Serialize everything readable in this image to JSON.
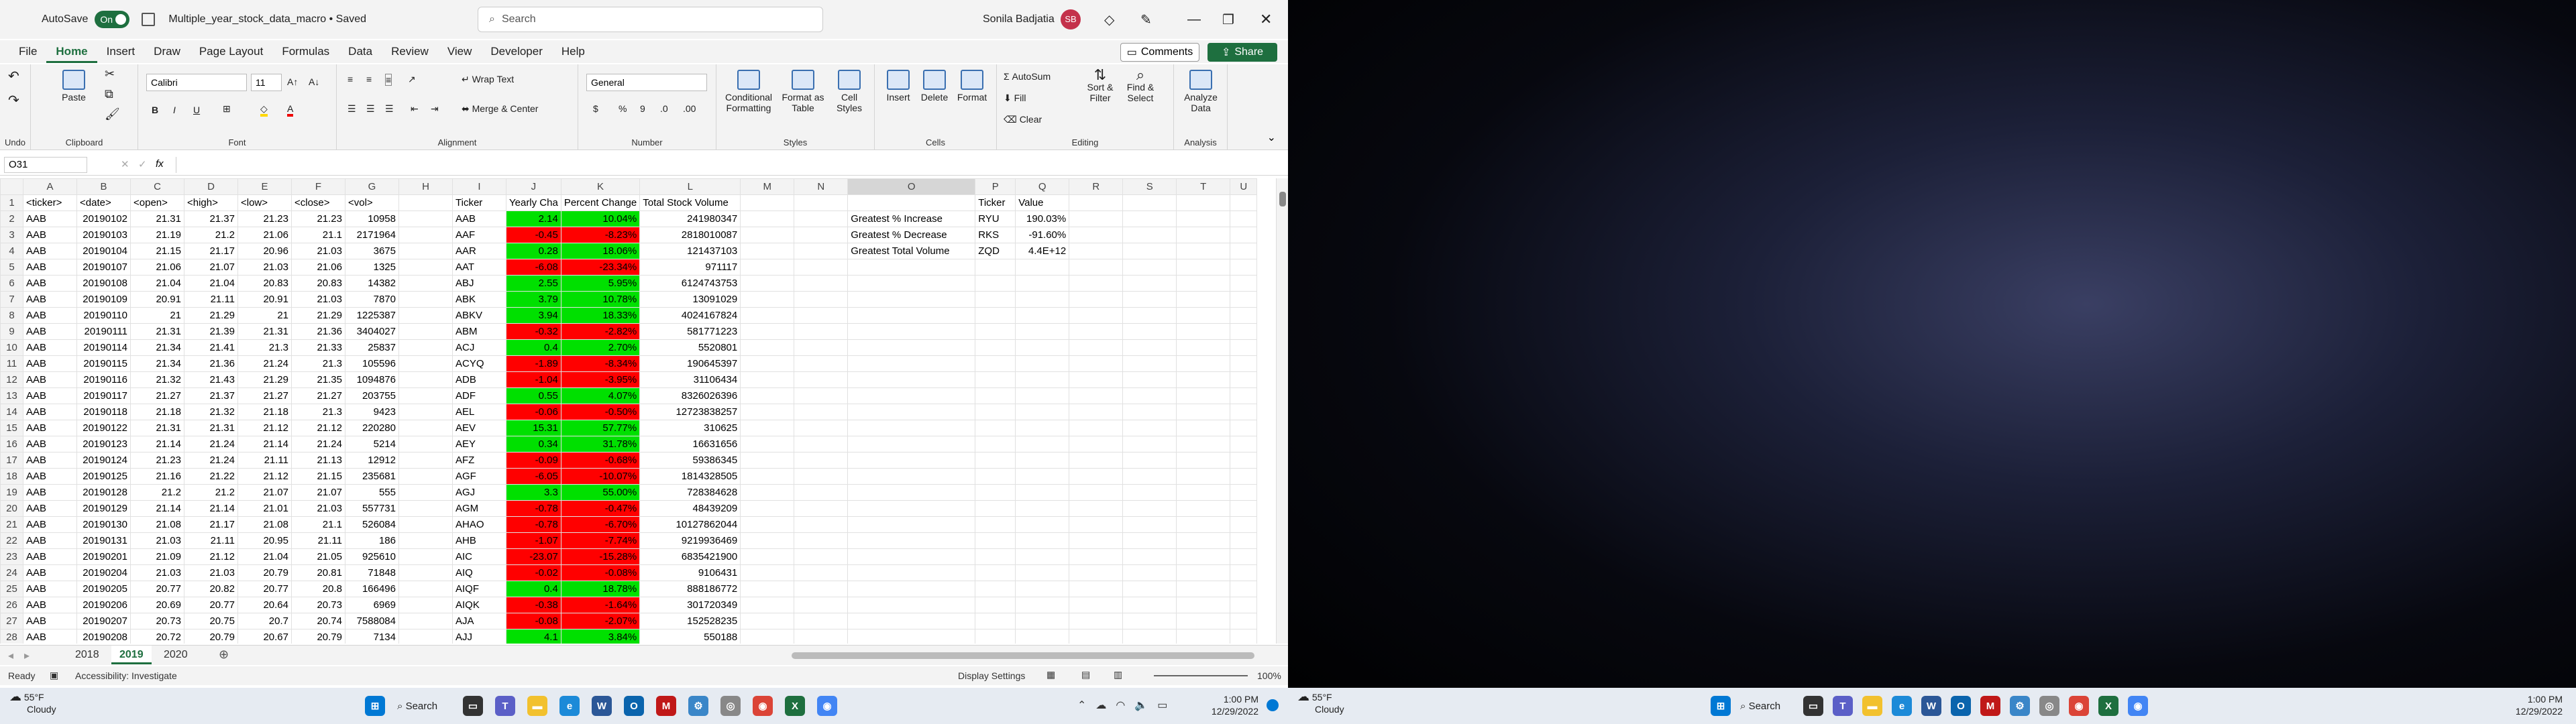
{
  "titlebar": {
    "autosave": "AutoSave",
    "toggle": "On",
    "filename": "Multiple_year_stock_data_macro • Saved",
    "search_placeholder": "Search",
    "user": "Sonila Badjatia",
    "initials": "SB"
  },
  "menu": [
    "File",
    "Home",
    "Insert",
    "Draw",
    "Page Layout",
    "Formulas",
    "Data",
    "Review",
    "View",
    "Developer",
    "Help"
  ],
  "buttons": {
    "comments": "Comments",
    "share": "Share"
  },
  "ribbon": {
    "undo": "Undo",
    "paste": "Paste",
    "clipboard": "Clipboard",
    "font_name": "Calibri",
    "font_size": "11",
    "font": "Font",
    "wrap": "Wrap Text",
    "merge": "Merge & Center",
    "alignment": "Alignment",
    "number_format": "General",
    "number": "Number",
    "conditional": "Conditional Formatting",
    "format_table": "Format as Table",
    "cell_styles": "Cell Styles",
    "styles": "Styles",
    "insert": "Insert",
    "delete": "Delete",
    "format": "Format",
    "cells": "Cells",
    "autosum": "AutoSum",
    "fill": "Fill",
    "clear": "Clear",
    "sort": "Sort & Filter",
    "find": "Find & Select",
    "editing": "Editing",
    "analyze": "Analyze Data",
    "analysis": "Analysis"
  },
  "formula_bar": {
    "name_box": "O31",
    "fx": "fx",
    "value": ""
  },
  "columns": [
    "A",
    "B",
    "C",
    "D",
    "E",
    "F",
    "G",
    "H",
    "I",
    "J",
    "K",
    "L",
    "M",
    "N",
    "O",
    "P",
    "Q",
    "R",
    "S",
    "T",
    "U"
  ],
  "rows": [
    [
      "<ticker>",
      "<date>",
      "<open>",
      "<high>",
      "<low>",
      "<close>",
      "<vol>",
      "",
      "Ticker",
      "Yearly Cha",
      "Percent Change",
      "Total Stock Volume",
      "",
      "",
      "",
      "Ticker",
      "Value",
      "",
      "",
      "",
      ""
    ],
    [
      "AAB",
      "20190102",
      "21.31",
      "21.37",
      "21.23",
      "21.23",
      "10958",
      "",
      "AAB",
      "2.14",
      "10.04%",
      "241980347",
      "",
      "",
      "Greatest % Increase",
      "RYU",
      "190.03%",
      "",
      "",
      "",
      ""
    ],
    [
      "AAB",
      "20190103",
      "21.19",
      "21.2",
      "21.06",
      "21.1",
      "2171964",
      "",
      "AAF",
      "-0.45",
      "-8.23%",
      "2818010087",
      "",
      "",
      "Greatest % Decrease",
      "RKS",
      "-91.60%",
      "",
      "",
      "",
      ""
    ],
    [
      "AAB",
      "20190104",
      "21.15",
      "21.17",
      "20.96",
      "21.03",
      "3675",
      "",
      "AAR",
      "0.28",
      "18.06%",
      "121437103",
      "",
      "",
      "Greatest Total Volume",
      "ZQD",
      "4.4E+12",
      "",
      "",
      "",
      ""
    ],
    [
      "AAB",
      "20190107",
      "21.06",
      "21.07",
      "21.03",
      "21.06",
      "1325",
      "",
      "AAT",
      "-6.08",
      "-23.34%",
      "971117",
      "",
      "",
      "",
      "",
      "",
      "",
      "",
      "",
      ""
    ],
    [
      "AAB",
      "20190108",
      "21.04",
      "21.04",
      "20.83",
      "20.83",
      "14382",
      "",
      "ABJ",
      "2.55",
      "5.95%",
      "6124743753",
      "",
      "",
      "",
      "",
      "",
      "",
      "",
      "",
      ""
    ],
    [
      "AAB",
      "20190109",
      "20.91",
      "21.11",
      "20.91",
      "21.03",
      "7870",
      "",
      "ABK",
      "3.79",
      "10.78%",
      "13091029",
      "",
      "",
      "",
      "",
      "",
      "",
      "",
      "",
      ""
    ],
    [
      "AAB",
      "20190110",
      "21",
      "21.29",
      "21",
      "21.29",
      "1225387",
      "",
      "ABKV",
      "3.94",
      "18.33%",
      "4024167824",
      "",
      "",
      "",
      "",
      "",
      "",
      "",
      "",
      ""
    ],
    [
      "AAB",
      "20190111",
      "21.31",
      "21.39",
      "21.31",
      "21.36",
      "3404027",
      "",
      "ABM",
      "-0.32",
      "-2.82%",
      "581771223",
      "",
      "",
      "",
      "",
      "",
      "",
      "",
      "",
      ""
    ],
    [
      "AAB",
      "20190114",
      "21.34",
      "21.41",
      "21.3",
      "21.33",
      "25837",
      "",
      "ACJ",
      "0.4",
      "2.70%",
      "5520801",
      "",
      "",
      "",
      "",
      "",
      "",
      "",
      "",
      ""
    ],
    [
      "AAB",
      "20190115",
      "21.34",
      "21.36",
      "21.24",
      "21.3",
      "105596",
      "",
      "ACYQ",
      "-1.89",
      "-8.34%",
      "190645397",
      "",
      "",
      "",
      "",
      "",
      "",
      "",
      "",
      ""
    ],
    [
      "AAB",
      "20190116",
      "21.32",
      "21.43",
      "21.29",
      "21.35",
      "1094876",
      "",
      "ADB",
      "-1.04",
      "-3.95%",
      "31106434",
      "",
      "",
      "",
      "",
      "",
      "",
      "",
      "",
      ""
    ],
    [
      "AAB",
      "20190117",
      "21.27",
      "21.37",
      "21.27",
      "21.27",
      "203755",
      "",
      "ADF",
      "0.55",
      "4.07%",
      "8326026396",
      "",
      "",
      "",
      "",
      "",
      "",
      "",
      "",
      ""
    ],
    [
      "AAB",
      "20190118",
      "21.18",
      "21.32",
      "21.18",
      "21.3",
      "9423",
      "",
      "AEL",
      "-0.06",
      "-0.50%",
      "12723838257",
      "",
      "",
      "",
      "",
      "",
      "",
      "",
      "",
      ""
    ],
    [
      "AAB",
      "20190122",
      "21.31",
      "21.31",
      "21.12",
      "21.12",
      "220280",
      "",
      "AEV",
      "15.31",
      "57.77%",
      "310625",
      "",
      "",
      "",
      "",
      "",
      "",
      "",
      "",
      ""
    ],
    [
      "AAB",
      "20190123",
      "21.14",
      "21.24",
      "21.14",
      "21.24",
      "5214",
      "",
      "AEY",
      "0.34",
      "31.78%",
      "16631656",
      "",
      "",
      "",
      "",
      "",
      "",
      "",
      "",
      ""
    ],
    [
      "AAB",
      "20190124",
      "21.23",
      "21.24",
      "21.11",
      "21.13",
      "12912",
      "",
      "AFZ",
      "-0.09",
      "-0.68%",
      "59386345",
      "",
      "",
      "",
      "",
      "",
      "",
      "",
      "",
      ""
    ],
    [
      "AAB",
      "20190125",
      "21.16",
      "21.22",
      "21.12",
      "21.15",
      "235681",
      "",
      "AGF",
      "-6.05",
      "-10.07%",
      "1814328505",
      "",
      "",
      "",
      "",
      "",
      "",
      "",
      "",
      ""
    ],
    [
      "AAB",
      "20190128",
      "21.2",
      "21.2",
      "21.07",
      "21.07",
      "555",
      "",
      "AGJ",
      "3.3",
      "55.00%",
      "728384628",
      "",
      "",
      "",
      "",
      "",
      "",
      "",
      "",
      ""
    ],
    [
      "AAB",
      "20190129",
      "21.14",
      "21.14",
      "21.01",
      "21.03",
      "557731",
      "",
      "AGM",
      "-0.78",
      "-0.47%",
      "48439209",
      "",
      "",
      "",
      "",
      "",
      "",
      "",
      "",
      ""
    ],
    [
      "AAB",
      "20190130",
      "21.08",
      "21.17",
      "21.08",
      "21.1",
      "526084",
      "",
      "AHAO",
      "-0.78",
      "-6.70%",
      "10127862044",
      "",
      "",
      "",
      "",
      "",
      "",
      "",
      "",
      ""
    ],
    [
      "AAB",
      "20190131",
      "21.03",
      "21.11",
      "20.95",
      "21.11",
      "186",
      "",
      "AHB",
      "-1.07",
      "-7.74%",
      "9219936469",
      "",
      "",
      "",
      "",
      "",
      "",
      "",
      "",
      ""
    ],
    [
      "AAB",
      "20190201",
      "21.09",
      "21.12",
      "21.04",
      "21.05",
      "925610",
      "",
      "AIC",
      "-23.07",
      "-15.28%",
      "6835421900",
      "",
      "",
      "",
      "",
      "",
      "",
      "",
      "",
      ""
    ],
    [
      "AAB",
      "20190204",
      "21.03",
      "21.03",
      "20.79",
      "20.81",
      "71848",
      "",
      "AIQ",
      "-0.02",
      "-0.08%",
      "9106431",
      "",
      "",
      "",
      "",
      "",
      "",
      "",
      "",
      ""
    ],
    [
      "AAB",
      "20190205",
      "20.77",
      "20.82",
      "20.77",
      "20.8",
      "166496",
      "",
      "AIQF",
      "0.4",
      "18.78%",
      "888186772",
      "",
      "",
      "",
      "",
      "",
      "",
      "",
      "",
      ""
    ],
    [
      "AAB",
      "20190206",
      "20.69",
      "20.77",
      "20.64",
      "20.73",
      "6969",
      "",
      "AIQK",
      "-0.38",
      "-1.64%",
      "301720349",
      "",
      "",
      "",
      "",
      "",
      "",
      "",
      "",
      ""
    ],
    [
      "AAB",
      "20190207",
      "20.73",
      "20.75",
      "20.7",
      "20.74",
      "7588084",
      "",
      "AJA",
      "-0.08",
      "-2.07%",
      "152528235",
      "",
      "",
      "",
      "",
      "",
      "",
      "",
      "",
      ""
    ],
    [
      "AAB",
      "20190208",
      "20.72",
      "20.79",
      "20.67",
      "20.79",
      "7134",
      "",
      "AJJ",
      "4.1",
      "3.84%",
      "550188",
      "",
      "",
      "",
      "",
      "",
      "",
      "",
      "",
      ""
    ]
  ],
  "sheets": [
    "2018",
    "2019",
    "2020"
  ],
  "active_sheet": "2019",
  "status": {
    "ready": "Ready",
    "accessibility": "Accessibility: Investigate",
    "display": "Display Settings",
    "zoom": "100%"
  },
  "taskbar_left": {
    "temp": "55°F",
    "cond": "Cloudy",
    "search": "Search",
    "time": "1:00 PM",
    "date": "12/29/2022"
  },
  "taskbar_right": {
    "temp": "55°F",
    "cond": "Cloudy",
    "search": "Search",
    "time": "1:00 PM",
    "date": "12/29/2022"
  },
  "colors": {
    "excel_green": "#1e6f3f",
    "positive": "#00e000",
    "negative": "#ff0000"
  }
}
